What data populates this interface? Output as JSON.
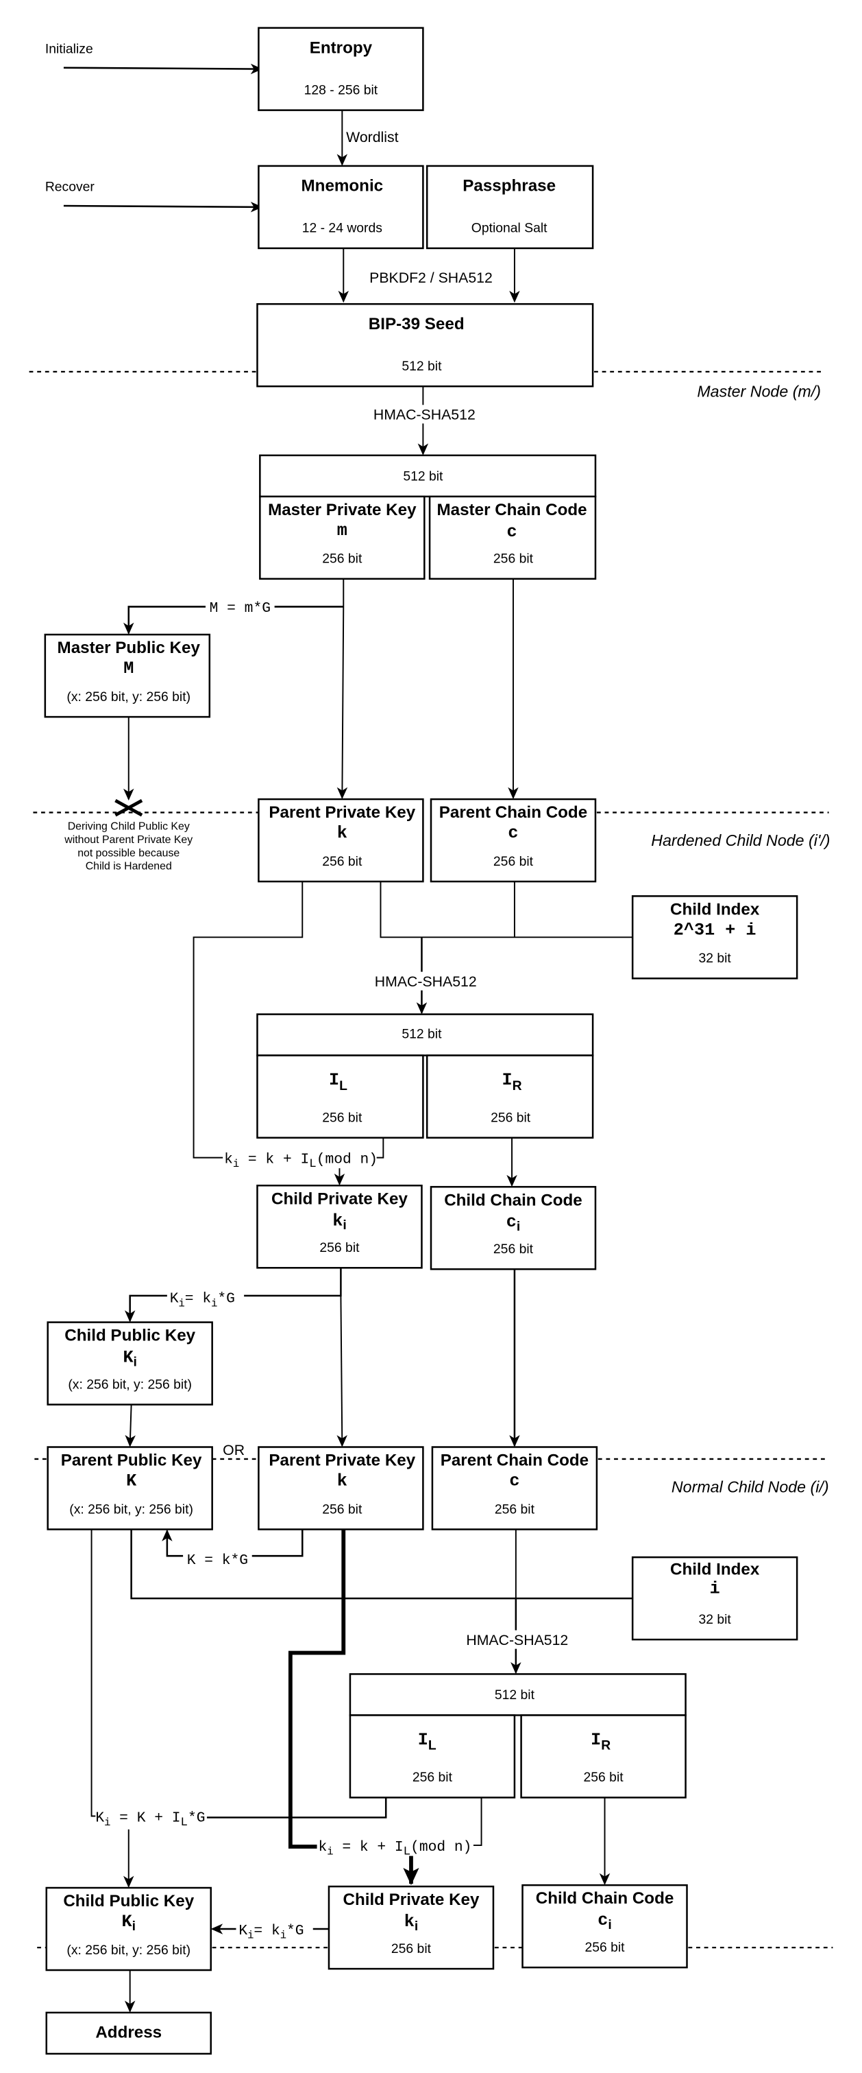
{
  "inputs": {
    "initialize": "Initialize",
    "recover": "Recover"
  },
  "entropy": {
    "title": "Entropy",
    "size": "128 - 256 bit"
  },
  "wordlist_label": "Wordlist",
  "mnemonic": {
    "title": "Mnemonic",
    "size": "12 - 24 words"
  },
  "passphrase": {
    "title": "Passphrase",
    "size": "Optional Salt"
  },
  "pbkdf2_label": "PBKDF2 / SHA512",
  "seed": {
    "title": "BIP-39 Seed",
    "size": "512 bit"
  },
  "levels": {
    "master": "Master Node (m/)",
    "hardened": "Hardened Child Node (i'/)",
    "normal": "Normal Child Node (i/)"
  },
  "hmac_label": "HMAC-SHA512",
  "bits_512": "512 bit",
  "bits_256": "256 bit",
  "bits_32": "32 bit",
  "xy_bits": "(x: 256 bit, y: 256 bit)",
  "master_private": {
    "title": "Master Private Key",
    "symbol": "m"
  },
  "master_chain": {
    "title": "Master Chain Code",
    "symbol": "c"
  },
  "master_public": {
    "title": "Master Public Key",
    "symbol": "M"
  },
  "master_public_formula": "M = m*G",
  "hardened_note": [
    "Deriving Child Public Key",
    "without Parent Private Key",
    "not possible because",
    "Child is Hardened"
  ],
  "parent_private": {
    "title": "Parent Private Key",
    "symbol": "k"
  },
  "parent_chain": {
    "title": "Parent Chain Code",
    "symbol": "c"
  },
  "parent_public": {
    "title": "Parent Public Key",
    "symbol": "K"
  },
  "child_index_hardened": {
    "title": "Child Index",
    "symbol": "2^31 + i"
  },
  "child_index_normal": {
    "title": "Child Index",
    "symbol": "i"
  },
  "il": {
    "base": "I",
    "sub": "L"
  },
  "ir": {
    "base": "I",
    "sub": "R"
  },
  "child_private": {
    "title": "Child Private Key",
    "base": "k",
    "sub": "i"
  },
  "child_chain": {
    "title": "Child Chain Code",
    "base": "c",
    "sub": "i"
  },
  "child_public": {
    "title": "Child Public Key",
    "base": "K",
    "sub": "i"
  },
  "formulas": {
    "ki_private": {
      "lhs": "k",
      "sub": "i",
      "rhs1": "= k + I",
      "sub2": "L",
      "rhs2": "(mod n)"
    },
    "Ki_from_ki": {
      "lhs": "K",
      "sub": "i",
      "rhs1": "= k",
      "sub2": "i",
      "rhs2": "*G"
    },
    "K_from_k": "K = k*G",
    "Ki_public": {
      "lhs": "K",
      "sub": "i",
      "rhs1": "= K + I",
      "sub2": "L",
      "rhs2": "*G"
    }
  },
  "or_label": "OR",
  "address": "Address"
}
